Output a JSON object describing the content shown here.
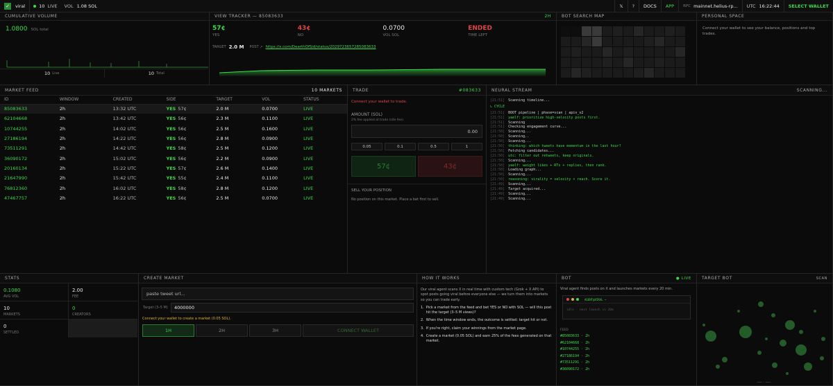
{
  "topbar": {
    "brand": "viral",
    "live_count": "10",
    "live_label": "LIVE",
    "vol_label": "VOL",
    "vol_value": "1.08 SOL",
    "x_label": "𝕏",
    "help_label": "?",
    "docs_label": "DOCS",
    "app_label": "APP",
    "rpc_label": "RPC",
    "rpc_value": "mainnet.helius-rp...",
    "utc_label": "UTC",
    "utc_value": "16:22:44",
    "wallet_label": "SELECT WALLET"
  },
  "cumulative": {
    "title": "CUMULATIVE VOLUME",
    "value": "1.0800",
    "unit": "SOL total",
    "live_count": "10",
    "live_label": "Live",
    "total_count": "10",
    "total_label": "Total"
  },
  "tracker": {
    "title": "VIEW TRACKER — 85083633",
    "window": "2H",
    "yes_price": "57¢",
    "yes_label": "YES",
    "no_price": "43¢",
    "no_label": "NO",
    "vol": "0.0700",
    "vol_label": "VOL SOL",
    "status": "ENDED",
    "status_label": "TIME LEFT",
    "target_label": "TARGET",
    "target_value": "2.0 M",
    "post_label": "POST ↗",
    "post_link": "https://x.com/DearthOfSid/status/2029723657285083633"
  },
  "botmap": {
    "title": "BOT SEARCH MAP"
  },
  "personal": {
    "title": "PERSONAL SPACE",
    "text": "Connect your wallet to see your balance, positions and top trades."
  },
  "feed": {
    "title": "MARKET FEED",
    "count": "10 MARKETS",
    "columns": [
      "ID",
      "WINDOW",
      "CREATED",
      "SIDE",
      "TARGET",
      "VOL",
      "STATUS"
    ],
    "rows": [
      {
        "id": "85083633",
        "window": "2h",
        "created": "13:32 UTC",
        "side": "YES",
        "price": "57¢",
        "target": "2.0 M",
        "vol": "0.0700",
        "status": "LIVE"
      },
      {
        "id": "62104668",
        "window": "2h",
        "created": "13:42 UTC",
        "side": "YES",
        "price": "56¢",
        "target": "2.3 M",
        "vol": "0.1100",
        "status": "LIVE"
      },
      {
        "id": "10744255",
        "window": "2h",
        "created": "14:02 UTC",
        "side": "YES",
        "price": "56¢",
        "target": "2.5 M",
        "vol": "0.1600",
        "status": "LIVE"
      },
      {
        "id": "27186194",
        "window": "2h",
        "created": "14:22 UTC",
        "side": "YES",
        "price": "56¢",
        "target": "2.8 M",
        "vol": "0.0900",
        "status": "LIVE"
      },
      {
        "id": "73511291",
        "window": "2h",
        "created": "14:42 UTC",
        "side": "YES",
        "price": "58¢",
        "target": "2.5 M",
        "vol": "0.1200",
        "status": "LIVE"
      },
      {
        "id": "36090172",
        "window": "2h",
        "created": "15:02 UTC",
        "side": "YES",
        "price": "56¢",
        "target": "2.2 M",
        "vol": "0.0900",
        "status": "LIVE"
      },
      {
        "id": "20160134",
        "window": "2h",
        "created": "15:22 UTC",
        "side": "YES",
        "price": "57¢",
        "target": "2.6 M",
        "vol": "0.1400",
        "status": "LIVE"
      },
      {
        "id": "21647990",
        "window": "2h",
        "created": "15:42 UTC",
        "side": "YES",
        "price": "55¢",
        "target": "2.4 M",
        "vol": "0.1100",
        "status": "LIVE"
      },
      {
        "id": "76812360",
        "window": "2h",
        "created": "16:02 UTC",
        "side": "YES",
        "price": "58¢",
        "target": "2.8 M",
        "vol": "0.1200",
        "status": "LIVE"
      },
      {
        "id": "47467757",
        "window": "2h",
        "created": "16:22 UTC",
        "side": "YES",
        "price": "56¢",
        "target": "2.5 M",
        "vol": "0.0700",
        "status": "LIVE"
      }
    ]
  },
  "trade": {
    "title": "TRADE",
    "market_id": "#083633",
    "connect_msg": "Connect your wallet to trade.",
    "amount_label": "AMOUNT (SOL)",
    "fee_note": "2% fee applied at trade (site fee).",
    "amount_value": "0.00",
    "quick": [
      "0.05",
      "0.1",
      "0.5",
      "1"
    ],
    "yes_btn": "57¢",
    "no_btn": "43¢",
    "sell_title": "SELL YOUR POSITION",
    "sell_text": "No position on this market. Place a bet first to sell."
  },
  "neural": {
    "title": "NEURAL STREAM",
    "status": "SCANNING...",
    "cycle_label": "↳ CYCLE",
    "lines": [
      {
        "ts": "[21:51]",
        "text": "Scanning timeline...",
        "c": "w"
      },
      {
        "ts": "[21:51]",
        "text": "BOOT pipeline | phase=scan | apiv_v2",
        "c": "w"
      },
      {
        "ts": "[21:51]",
        "text": "yaelf: prioritize high-velocity posts first.",
        "c": "g"
      },
      {
        "ts": "[21:51]",
        "text": "Scanning",
        "c": "w"
      },
      {
        "ts": "[21:51]",
        "text": "Checking engagement curve...",
        "c": "w"
      },
      {
        "ts": "[21:50]",
        "text": "Scanning...",
        "c": "w"
      },
      {
        "ts": "[21:50]",
        "text": "Scanning..",
        "c": "w"
      },
      {
        "ts": "[21:50]",
        "text": "Scanning...",
        "c": "w"
      },
      {
        "ts": "[21:50]",
        "text": "thinking: which tweets have momentum in the last hour?",
        "c": "g"
      },
      {
        "ts": "[21:50]",
        "text": "Fetching candidates...",
        "c": "w"
      },
      {
        "ts": "[21:50]",
        "text": "utc: filter out retweets, keep originals.",
        "c": "g"
      },
      {
        "ts": "[21:50]",
        "text": "Scanning...",
        "c": "w"
      },
      {
        "ts": "[21:50]",
        "text": "yaelf: weight likes + RTs + replies, then rank.",
        "c": "g"
      },
      {
        "ts": "[21:50]",
        "text": "Loading graph...",
        "c": "w"
      },
      {
        "ts": "[21:50]",
        "text": "Scanning...",
        "c": "w"
      },
      {
        "ts": "[21:50]",
        "text": "reasoning: virality = velocity × reach. Score it.",
        "c": "g"
      },
      {
        "ts": "[21:49]",
        "text": "Scanning...",
        "c": "w"
      },
      {
        "ts": "[21:49]",
        "text": "Target acquired...",
        "c": "w"
      },
      {
        "ts": "[21:49]",
        "text": "Scanning...",
        "c": "w"
      },
      {
        "ts": "[21:49]",
        "text": "Scanning...",
        "c": "w"
      }
    ]
  },
  "stats": {
    "title": "STATS",
    "avg_vol": "0.1080",
    "avg_vol_label": "AVG VOL",
    "fee": "2.00",
    "fee_label": "FEE",
    "markets": "10",
    "markets_label": "MARKETS",
    "creators": "0",
    "creators_label": "CREATORS",
    "settled": "0",
    "settled_label": "SETTLED"
  },
  "create": {
    "title": "CREATE MARKET",
    "url_placeholder": "paste tweet url...",
    "target_label": "Target (3–5 M)",
    "target_value": "4000000",
    "connect_msg": "Connect your wallet to create a market (0.05 SOL).",
    "windows": [
      "1H",
      "2H",
      "3H"
    ],
    "connect_btn": "CONNECT WALLET"
  },
  "how": {
    "title": "HOW IT WORKS",
    "intro": "Our viral agent scans X in real time with custom tech (Grok + X API) to spot posts going viral before everyone else — we turn them into markets so you can trade early.",
    "steps": [
      "Pick a market from the feed and bet YES or NO with SOL — will this post hit the target (3–5 M views)?",
      "When the time window ends, the outcome is settled: target hit or not.",
      "If you're right, claim your winnings from the market page.",
      "Create a market (0.05 SOL) and earn 25% of the fees generated on that market."
    ]
  },
  "bot": {
    "title": "BOT",
    "live_label": "● LIVE",
    "desc": "Viral agent finds posts on X and launches markets every 20 min.",
    "terminal_title": "AGENT@VIRAL ~",
    "terminal_line": "idle · next launch in 20m",
    "feed_label": "FEED",
    "ids": [
      "#85083633 · 2h",
      "#62104668 · 2h",
      "#10744255 · 2h",
      "#27186194 · 2h",
      "#73511291 · 2h",
      "#36090172 · 2h"
    ]
  },
  "targetbot": {
    "title": "TARGET BOT",
    "scan_label": "SCAN",
    "footer": "━━━ ·· ━━━ ·"
  },
  "colors": {
    "accent": "#3ddc4a",
    "red": "#e04545",
    "bg": "#0b0b0b",
    "panel": "#0e0e0e"
  }
}
